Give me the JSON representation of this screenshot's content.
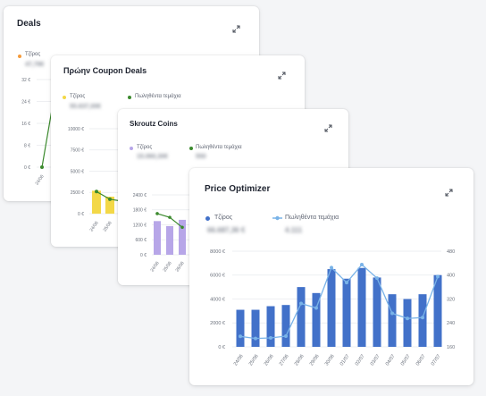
{
  "colors": {
    "orange": "#f59b3c",
    "green": "#3c8a2e",
    "yellow": "#f3d847",
    "purple": "#b7a6e8",
    "blue": "#4271c9",
    "light_blue": "#79b3e8",
    "grid": "#e8eaee"
  },
  "card_deals": {
    "title": "Deals",
    "legend_revenue": "Τζίρος",
    "revenue_value": "47,78€",
    "expand_icon": "expand-icon",
    "chart_data": {
      "type": "line",
      "y_ticks": [
        "32 €",
        "24 €",
        "16 €",
        "8 €",
        "0 €"
      ],
      "ylim": [
        0,
        32
      ],
      "x_ticks": [
        "24/06",
        "25/06"
      ],
      "series": [
        {
          "name": "Τζίρος",
          "values": [
            0,
            38
          ]
        }
      ]
    }
  },
  "card_coupon": {
    "title": "Πρώην Coupon Deals",
    "legend_revenue": "Τζίρος",
    "legend_units": "Πωληθέντα τεμάχια",
    "revenue_value": "55.637,00€",
    "expand_icon": "expand-icon",
    "chart_data": {
      "type": "bar",
      "y_ticks": [
        "10000 €",
        "7500 €",
        "5000 €",
        "2500 €",
        "0 €"
      ],
      "ylim": [
        0,
        10000
      ],
      "categories": [
        "24/06",
        "25/06"
      ],
      "series": [
        {
          "name": "Τζίρος",
          "values": [
            2700,
            2000
          ]
        },
        {
          "name": "Πωληθέντα τεμάχια",
          "values": [
            2600,
            1700
          ]
        }
      ]
    }
  },
  "card_skroutz": {
    "title": "Skroutz Coins",
    "legend_revenue": "Τζίρος",
    "legend_units": "Πωληθέντα τεμάχια",
    "revenue_value": "15.060,30€",
    "units_value": "550",
    "expand_icon": "expand-icon",
    "chart_data": {
      "type": "bar",
      "y_ticks": [
        "2400 €",
        "1800 €",
        "1200 €",
        "600 €",
        "0 €"
      ],
      "ylim": [
        0,
        2400
      ],
      "categories": [
        "24/06",
        "25/06",
        "26/06"
      ],
      "series": [
        {
          "name": "Τζίρος",
          "values": [
            1350,
            1150,
            1400
          ]
        },
        {
          "name": "Πωληθέντα τεμάχια",
          "values": [
            1650,
            1500,
            1100
          ]
        }
      ]
    }
  },
  "card_optimizer": {
    "title": "Price Optimizer",
    "legend_revenue": "Τζίρος",
    "legend_units": "Πωληθέντα τεμάχια",
    "revenue_value": "66.687,36 €",
    "units_value": "4.111",
    "expand_icon": "expand-icon",
    "chart_data": {
      "type": "bar",
      "y_ticks": [
        "8000 €",
        "6000 €",
        "4000 €",
        "2000 €",
        "0 €"
      ],
      "ylim": [
        0,
        8000
      ],
      "y2_ticks": [
        "480",
        "400",
        "320",
        "240",
        "160"
      ],
      "y2lim": [
        160,
        480
      ],
      "categories": [
        "24/06",
        "25/06",
        "26/06",
        "27/06",
        "28/06",
        "29/06",
        "30/06",
        "01/07",
        "02/07",
        "03/07",
        "04/07",
        "05/07",
        "06/07",
        "07/07"
      ],
      "series": [
        {
          "name": "Τζίρος",
          "values": [
            3100,
            3100,
            3400,
            3500,
            5000,
            4500,
            6500,
            5700,
            6600,
            5800,
            4400,
            4000,
            4400,
            6000
          ]
        },
        {
          "name": "Πωληθέντα τεμάχια",
          "values": [
            195,
            188,
            190,
            196,
            305,
            290,
            425,
            375,
            435,
            390,
            272,
            255,
            258,
            395
          ]
        }
      ]
    }
  }
}
